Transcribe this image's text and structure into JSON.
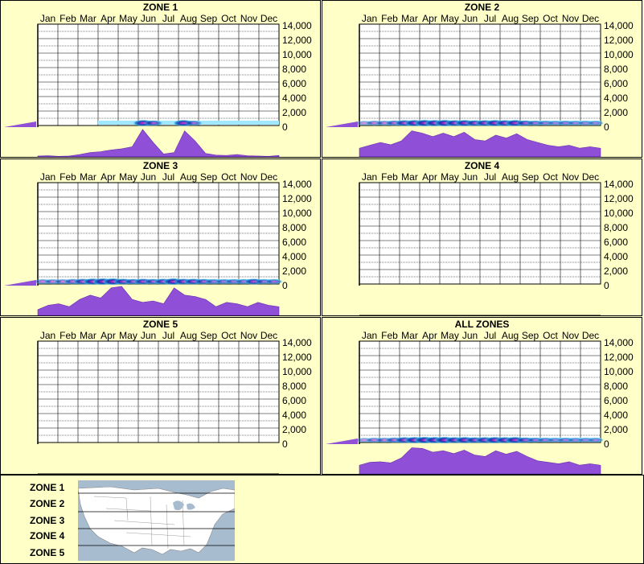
{
  "months": [
    "Jan",
    "Feb",
    "Mar",
    "Apr",
    "May",
    "Jun",
    "Jul",
    "Aug",
    "Sep",
    "Oct",
    "Nov",
    "Dec"
  ],
  "y_ticks": [
    "14,000",
    "12,000",
    "10,000",
    "8,000",
    "6,000",
    "4,000",
    "2,000",
    "0"
  ],
  "colors": {
    "background": "#ffffc8",
    "grid": "#000000",
    "fill": "#8f4fd6",
    "fill_stroke": "#6a2fb0",
    "band_light": "#9fe8ff",
    "band_mid": "#1f8fd0",
    "band_dark": "#1c2bb0",
    "band_hot": "#ff1cc8"
  },
  "chart_data": [
    {
      "type": "heatmap",
      "title": "ZONE 1",
      "ylim": [
        0,
        14000
      ],
      "x": [
        "Jan",
        "Feb",
        "Mar",
        "Apr",
        "May",
        "Jun",
        "Jul",
        "Aug",
        "Sep",
        "Oct",
        "Nov",
        "Dec"
      ],
      "profile": [
        0.03,
        0.04,
        0.02,
        0.03,
        0.08,
        0.15,
        0.18,
        0.24,
        0.28,
        0.35,
        0.95,
        0.5,
        0.1,
        0.15,
        0.9,
        0.55,
        0.12,
        0.06,
        0.05,
        0.08,
        0.04,
        0.03,
        0.02,
        0.05
      ],
      "band": [
        0.1,
        0.1,
        0.1,
        0.1,
        0.1,
        0.1,
        0.25,
        0.3,
        0.35,
        0.4,
        0.9,
        0.7,
        0.3,
        0.35,
        0.9,
        0.6,
        0.3,
        0.2,
        0.2,
        0.2,
        0.1,
        0.1,
        0.1,
        0.1
      ],
      "elev_bar": 0.35
    },
    {
      "type": "heatmap",
      "title": "ZONE 2",
      "ylim": [
        0,
        14000
      ],
      "x": [
        "Jan",
        "Feb",
        "Mar",
        "Apr",
        "May",
        "Jun",
        "Jul",
        "Aug",
        "Sep",
        "Oct",
        "Nov",
        "Dec"
      ],
      "profile": [
        0.3,
        0.4,
        0.5,
        0.42,
        0.55,
        0.9,
        0.82,
        0.7,
        0.82,
        0.7,
        0.85,
        0.6,
        0.55,
        0.75,
        0.65,
        0.8,
        0.6,
        0.5,
        0.4,
        0.35,
        0.4,
        0.3,
        0.35,
        0.3
      ],
      "band": [
        0.5,
        0.6,
        0.6,
        0.7,
        0.85,
        0.9,
        0.95,
        0.9,
        0.95,
        0.85,
        0.9,
        0.8,
        0.85,
        0.9,
        0.85,
        0.9,
        0.7,
        0.6,
        0.55,
        0.5,
        0.55,
        0.5,
        0.5,
        0.5
      ],
      "elev_bar": 0.35
    },
    {
      "type": "heatmap",
      "title": "ZONE 3",
      "ylim": [
        0,
        14000
      ],
      "x": [
        "Jan",
        "Feb",
        "Mar",
        "Apr",
        "May",
        "Jun",
        "Jul",
        "Aug",
        "Sep",
        "Oct",
        "Nov",
        "Dec"
      ],
      "profile": [
        0.2,
        0.35,
        0.4,
        0.3,
        0.55,
        0.7,
        0.6,
        0.95,
        1.0,
        0.55,
        0.45,
        0.5,
        0.4,
        0.95,
        0.7,
        0.65,
        0.55,
        0.3,
        0.45,
        0.4,
        0.3,
        0.45,
        0.35,
        0.3
      ],
      "band": [
        0.6,
        0.6,
        0.6,
        0.7,
        0.8,
        0.9,
        0.95,
        0.95,
        0.8,
        0.7,
        0.8,
        0.7,
        0.8,
        0.95,
        0.8,
        0.8,
        0.7,
        0.6,
        0.6,
        0.6,
        0.6,
        0.8,
        0.6,
        0.6
      ],
      "elev_bar": 0.35
    },
    {
      "type": "heatmap",
      "title": "ZONE 4",
      "ylim": [
        0,
        14000
      ],
      "x": [
        "Jan",
        "Feb",
        "Mar",
        "Apr",
        "May",
        "Jun",
        "Jul",
        "Aug",
        "Sep",
        "Oct",
        "Nov",
        "Dec"
      ],
      "profile": [],
      "band": [],
      "elev_bar": 0
    },
    {
      "type": "heatmap",
      "title": "ZONE 5",
      "ylim": [
        0,
        14000
      ],
      "x": [
        "Jan",
        "Feb",
        "Mar",
        "Apr",
        "May",
        "Jun",
        "Jul",
        "Aug",
        "Sep",
        "Oct",
        "Nov",
        "Dec"
      ],
      "profile": [],
      "band": [],
      "elev_bar": 0
    },
    {
      "type": "heatmap",
      "title": "ALL ZONES",
      "ylim": [
        0,
        14000
      ],
      "x": [
        "Jan",
        "Feb",
        "Mar",
        "Apr",
        "May",
        "Jun",
        "Jul",
        "Aug",
        "Sep",
        "Oct",
        "Nov",
        "Dec"
      ],
      "profile": [
        0.3,
        0.4,
        0.42,
        0.38,
        0.55,
        0.9,
        0.88,
        0.75,
        0.8,
        0.7,
        0.82,
        0.65,
        0.6,
        0.8,
        0.68,
        0.78,
        0.6,
        0.45,
        0.4,
        0.35,
        0.42,
        0.3,
        0.35,
        0.3
      ],
      "band": [
        0.5,
        0.6,
        0.6,
        0.7,
        0.85,
        0.9,
        0.95,
        0.9,
        0.95,
        0.85,
        0.9,
        0.8,
        0.85,
        0.9,
        0.85,
        0.9,
        0.7,
        0.6,
        0.55,
        0.5,
        0.55,
        0.5,
        0.5,
        0.5
      ],
      "elev_bar": 0.35
    }
  ],
  "legend": {
    "zones": [
      "ZONE 1",
      "ZONE 2",
      "ZONE 3",
      "ZONE 4",
      "ZONE 5"
    ]
  }
}
